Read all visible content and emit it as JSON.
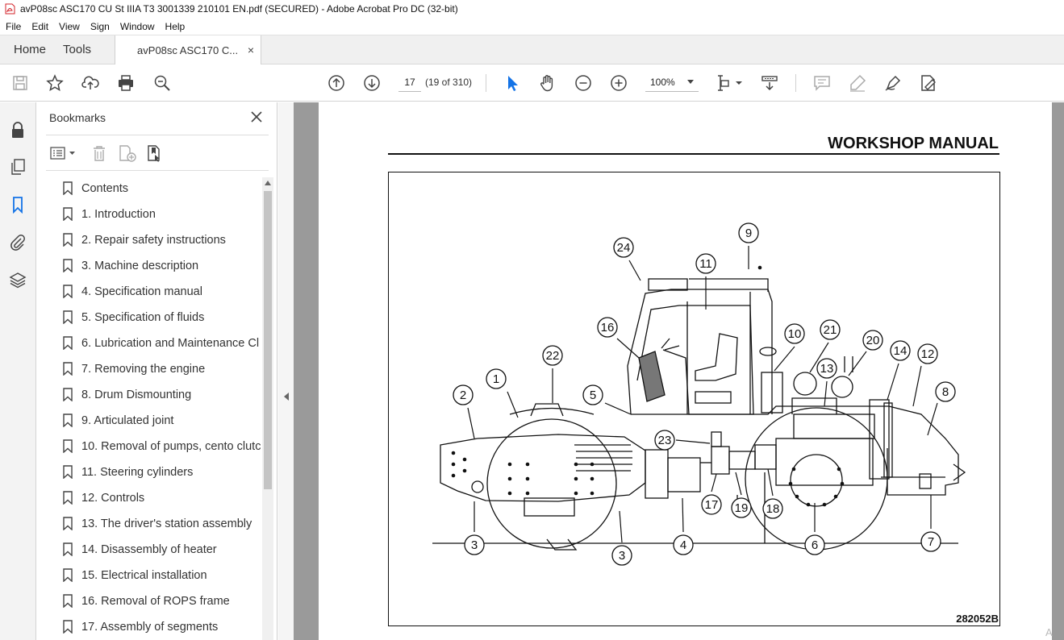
{
  "window": {
    "title": "avP08sc ASC170 CU St IIIA T3 3001339 210101 EN.pdf (SECURED) - Adobe Acrobat Pro DC (32-bit)"
  },
  "menu": [
    "File",
    "Edit",
    "View",
    "Sign",
    "Window",
    "Help"
  ],
  "tabs": {
    "home": "Home",
    "tools": "Tools",
    "document": "avP08sc ASC170 C...",
    "close_glyph": "×"
  },
  "toolbar": {
    "page_number": "17",
    "page_of": "(19 of 310)",
    "zoom": "100%"
  },
  "bookmarks": {
    "title": "Bookmarks",
    "items": [
      "Contents",
      "1. Introduction",
      "2. Repair safety instructions",
      "3. Machine description",
      "4. Specification manual",
      "5. Specification of fluids",
      "6. Lubrication and Maintenance Cl",
      "7. Removing the engine",
      "8. Drum Dismounting",
      "9. Articulated joint",
      "10. Removal of pumps, cento clutc",
      "11. Steering cylinders",
      "12. Controls",
      "13. The driver's station assembly",
      "14. Disassembly of heater",
      "15. Electrical installation",
      "16. Removal of ROPS frame",
      "17. Assembly of segments"
    ]
  },
  "document": {
    "heading": "WORKSHOP MANUAL",
    "figure_code": "282052B",
    "callouts": [
      "1",
      "2",
      "3",
      "3",
      "4",
      "5",
      "6",
      "7",
      "8",
      "9",
      "10",
      "11",
      "12",
      "13",
      "14",
      "16",
      "17",
      "18",
      "19",
      "20",
      "21",
      "22",
      "23",
      "24"
    ],
    "corner_hint": "A"
  },
  "colors": {
    "accent": "#1473e6",
    "doc_background": "#9a9a9a",
    "pdf_red": "#d3232a"
  }
}
